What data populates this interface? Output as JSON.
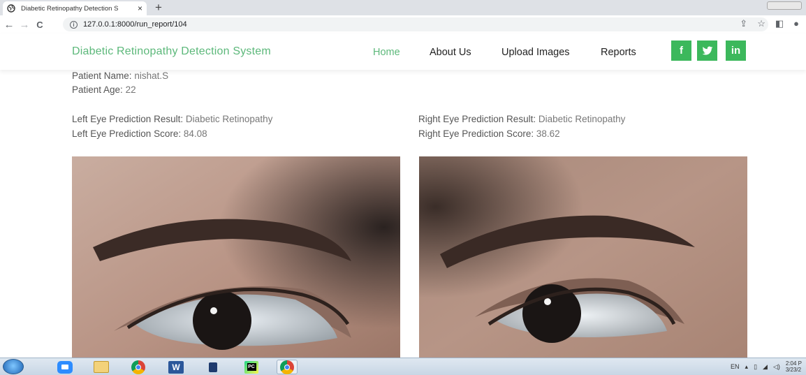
{
  "browser": {
    "tab_title": "Diabetic Retinopathy Detection S",
    "tab_close": "×",
    "new_tab": "+",
    "url": "127.0.0.1:8000/run_report/104"
  },
  "site": {
    "brand": "Diabetic Retinopathy Detection System",
    "nav": [
      "Home",
      "About Us",
      "Upload Images",
      "Reports"
    ],
    "social": [
      "f",
      "t",
      "in"
    ],
    "accent_color": "#5cb87a",
    "social_color": "#3cb85c"
  },
  "report": {
    "patient_name_label": "Patient Name:",
    "patient_name": "nishat.S",
    "patient_age_label": "Patient Age:",
    "patient_age": "22",
    "left_result_label": "Left Eye Prediction Result:",
    "left_result": "Diabetic Retinopathy",
    "left_score_label": "Left Eye Prediction Score:",
    "left_score": "84.08",
    "right_result_label": "Right Eye Prediction Result:",
    "right_result": "Diabetic Retinopathy",
    "right_score_label": "Right Eye Prediction Score:",
    "right_score": "38.62"
  },
  "taskbar": {
    "apps": [
      "windows-start",
      "zoom",
      "file-explorer",
      "chrome",
      "word",
      "app",
      "pycharm",
      "chrome"
    ],
    "lang": "EN",
    "time": "2:04 P",
    "date": "3/23/2"
  }
}
